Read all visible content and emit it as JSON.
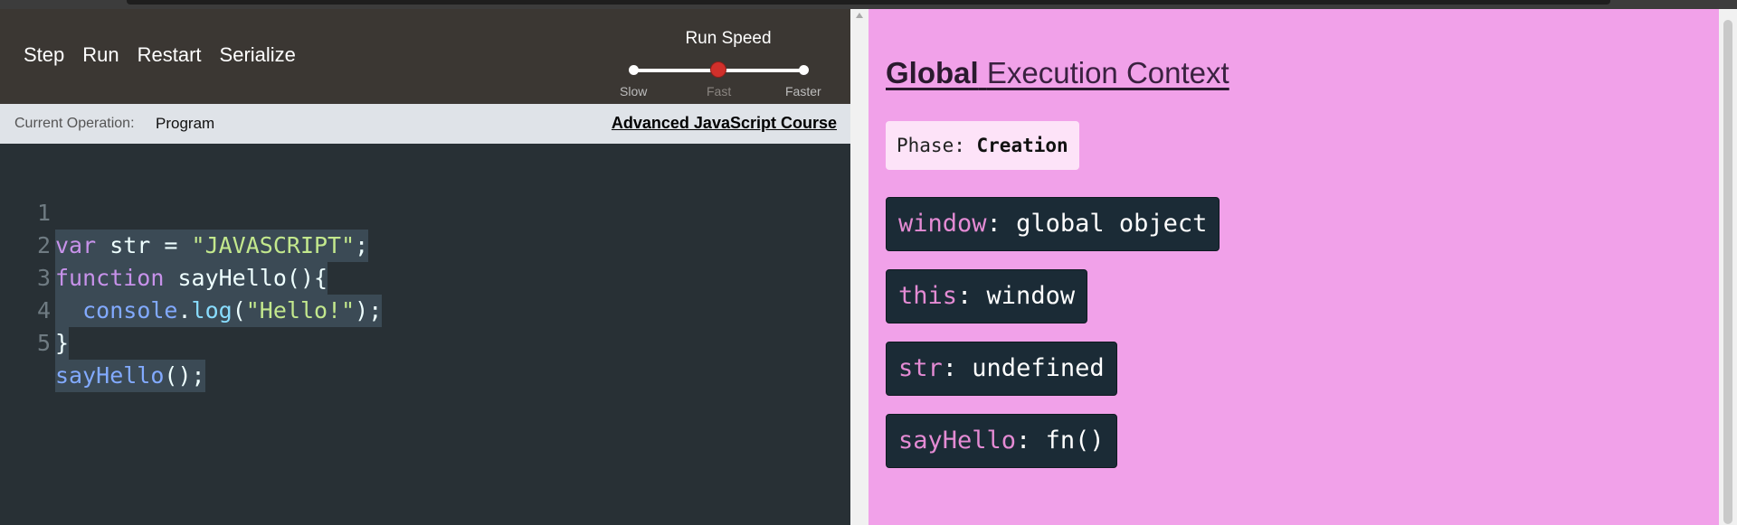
{
  "toolbar": {
    "buttons": [
      "Step",
      "Run",
      "Restart",
      "Serialize"
    ],
    "run_speed": {
      "title": "Run Speed",
      "labels": [
        "Slow",
        "Fast",
        "Faster"
      ],
      "selected": "Fast",
      "selected_index": 1
    }
  },
  "status_bar": {
    "current_operation_label": "Current Operation:",
    "current_operation_value": "Program",
    "course_link": "Advanced JavaScript Course"
  },
  "editor": {
    "line_numbers": [
      "1",
      "2",
      "3",
      "4",
      "5"
    ],
    "lines": [
      "var str = \"JAVASCRIPT\";",
      "function sayHello(){",
      "  console.log(\"Hello!\");",
      "}",
      "sayHello();"
    ]
  },
  "context": {
    "title_bold": "Global",
    "title_rest": "Execution Context",
    "phase_label": "Phase:",
    "phase_value": "Creation",
    "variables": [
      {
        "name": "window",
        "value": "global object"
      },
      {
        "name": "this",
        "value": "window"
      },
      {
        "name": "str",
        "value": "undefined"
      },
      {
        "name": "sayHello",
        "value": "fn()"
      }
    ]
  },
  "colors": {
    "toolbar_bg": "#3b3733",
    "editor_bg": "#283035",
    "context_bg": "#f1a1e9",
    "variable_bg": "#1b2b36",
    "slider_thumb": "#d0302b"
  }
}
